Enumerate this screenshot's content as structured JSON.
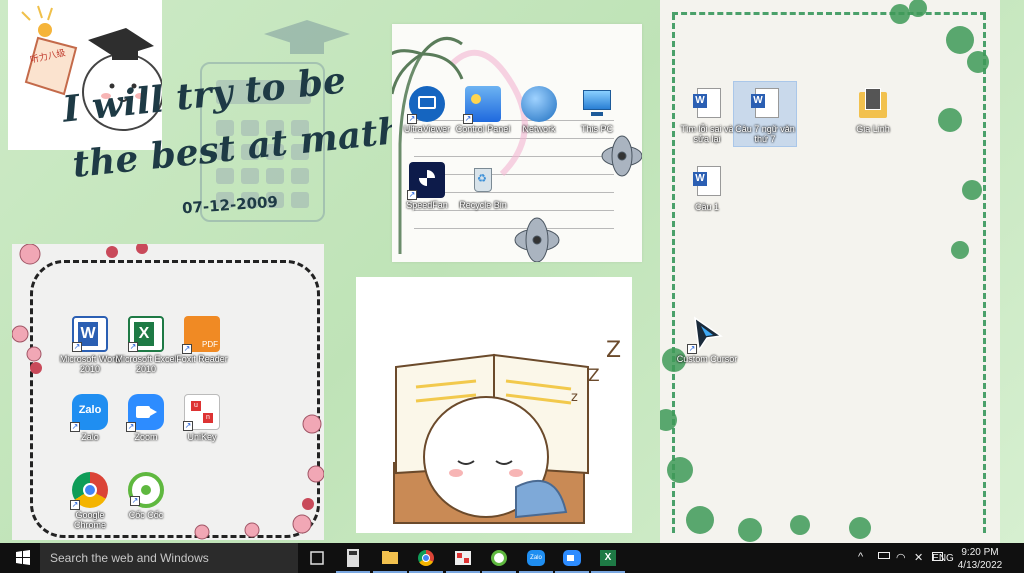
{
  "wallpaper": {
    "tagline_line1": "I will try to be",
    "tagline_line2": "the best at math",
    "date": "07-12-2009",
    "sticker_text": "听力八级"
  },
  "desktop_icons_left": [
    {
      "label": "Microsoft Word 2010",
      "icon": "word-icon"
    },
    {
      "label": "Microsoft Excel 2010",
      "icon": "excel-icon"
    },
    {
      "label": "Foxit Reader",
      "icon": "foxit-pdf-icon"
    },
    {
      "label": "Zalo",
      "icon": "zalo-icon"
    },
    {
      "label": "Zoom",
      "icon": "zoom-icon"
    },
    {
      "label": "UniKey",
      "icon": "unikey-icon"
    },
    {
      "label": "Google Chrome",
      "icon": "chrome-icon"
    },
    {
      "label": "Cốc Cốc",
      "icon": "coccoc-icon"
    }
  ],
  "desktop_icons_top": [
    {
      "label": "UltraViewer",
      "icon": "ultraviewer-icon"
    },
    {
      "label": "Control Panel",
      "icon": "control-panel-icon"
    },
    {
      "label": "Network",
      "icon": "network-icon"
    },
    {
      "label": "This PC",
      "icon": "this-pc-icon"
    },
    {
      "label": "SpeedFan",
      "icon": "speedfan-icon"
    },
    {
      "label": "Recycle Bin",
      "icon": "recycle-bin-icon"
    }
  ],
  "desktop_icons_right": [
    {
      "label": "Tìm lỗi sai và sửa lại",
      "icon": "word-doc-icon"
    },
    {
      "label": "Câu 7 ngữ văn thứ 7",
      "icon": "word-doc-icon",
      "selected": true
    },
    {
      "label": "Gia Linh",
      "icon": "folder-icon"
    },
    {
      "label": "Câu 1",
      "icon": "word-doc-icon"
    },
    {
      "label": "Custom Cursor",
      "icon": "custom-cursor-icon"
    }
  ],
  "taskbar": {
    "search_placeholder": "Search the web and Windows",
    "pinned": [
      "task-view-icon",
      "calculator-icon",
      "file-explorer-icon",
      "chrome-icon",
      "unikey-icon",
      "coccoc-icon",
      "zalo-icon",
      "zoom-icon",
      "excel-icon"
    ],
    "language": "ENG",
    "time": "9:20 PM",
    "date": "4/13/2022"
  },
  "colors": {
    "background": "#c9e7c2",
    "accent_green": "#4aa06a",
    "title_ink": "#1e3a45",
    "taskbar": "#101010"
  }
}
